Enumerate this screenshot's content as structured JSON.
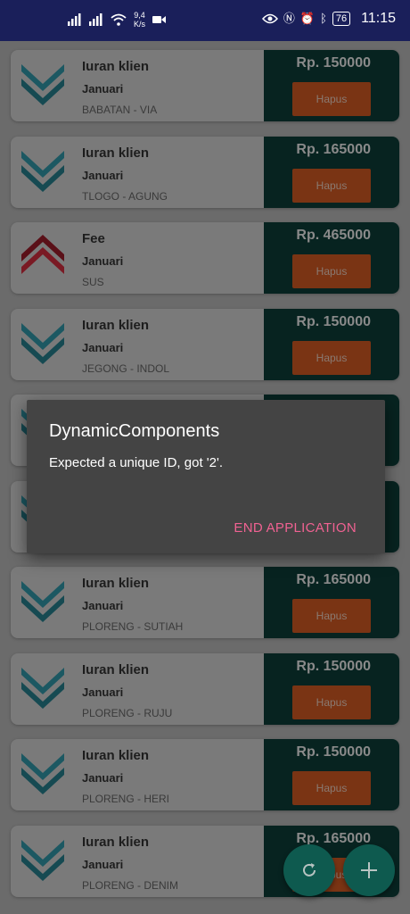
{
  "status_bar": {
    "net_speed_value": "9,4",
    "net_speed_unit": "K/s",
    "battery": "76",
    "time": "11:15"
  },
  "items": [
    {
      "title": "Iuran klien",
      "month": "Januari",
      "location": "BABATAN - VIA",
      "amount": "Rp. 150000",
      "delete_label": "Hapus",
      "icon": "chevron-down-teal"
    },
    {
      "title": "Iuran klien",
      "month": "Januari",
      "location": "TLOGO - AGUNG",
      "amount": "Rp. 165000",
      "delete_label": "Hapus",
      "icon": "chevron-down-teal"
    },
    {
      "title": "Fee",
      "month": "Januari",
      "location": "SUS",
      "amount": "Rp. 465000",
      "delete_label": "Hapus",
      "icon": "chevron-up-red"
    },
    {
      "title": "Iuran klien",
      "month": "Januari",
      "location": "JEGONG - INDOL",
      "amount": "Rp. 150000",
      "delete_label": "Hapus",
      "icon": "chevron-down-teal"
    },
    {
      "title": "",
      "month": "",
      "location": "",
      "amount": "",
      "delete_label": "",
      "icon": "chevron-down-teal"
    },
    {
      "title": "",
      "month": "",
      "location": "",
      "amount": "",
      "delete_label": "",
      "icon": "chevron-down-teal"
    },
    {
      "title": "Iuran klien",
      "month": "Januari",
      "location": "PLORENG - SUTIAH",
      "amount": "Rp. 165000",
      "delete_label": "Hapus",
      "icon": "chevron-down-teal"
    },
    {
      "title": "Iuran klien",
      "month": "Januari",
      "location": "PLORENG - RUJU",
      "amount": "Rp. 150000",
      "delete_label": "Hapus",
      "icon": "chevron-down-teal"
    },
    {
      "title": "Iuran klien",
      "month": "Januari",
      "location": "PLORENG - HERI",
      "amount": "Rp. 150000",
      "delete_label": "Hapus",
      "icon": "chevron-down-teal"
    },
    {
      "title": "Iuran klien",
      "month": "Januari",
      "location": "PLORENG - DENIM",
      "amount": "Rp. 165000",
      "delete_label": "Hapus",
      "icon": "chevron-down-teal"
    }
  ],
  "dialog": {
    "title": "DynamicComponents",
    "message": "Expected a unique ID, got '2'.",
    "button": "END APPLICATION"
  },
  "fabs": {
    "refresh_icon": "refresh-icon",
    "add_icon": "plus-icon"
  },
  "colors": {
    "status_bar": "#1a1f5a",
    "dialog_button": "#f06292",
    "fab": "#0e5a4f",
    "delete_button": "#d84315",
    "card_right": "#072320"
  }
}
